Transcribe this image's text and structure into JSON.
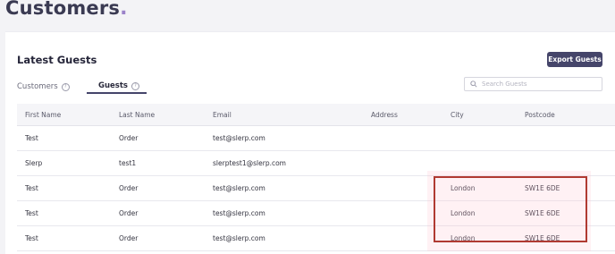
{
  "header": {
    "title": "Customers",
    "title_dot": "."
  },
  "section": {
    "title": "Latest Guests",
    "export_label": "Export Guests"
  },
  "tabs": [
    {
      "label": "Customers",
      "active": false
    },
    {
      "label": "Guests",
      "active": true
    }
  ],
  "search": {
    "placeholder": "Search Guests",
    "value": ""
  },
  "table": {
    "columns": [
      "First Name",
      "Last Name",
      "Email",
      "Address",
      "City",
      "Postcode"
    ],
    "rows": [
      [
        "Test",
        "Order",
        "test@slerp.com",
        "",
        "",
        ""
      ],
      [
        "Slerp",
        "test1",
        "slerptest1@slerp.com",
        "",
        "",
        ""
      ],
      [
        "Test",
        "Order",
        "test@slerp.com",
        "",
        "London",
        "SW1E 6DE"
      ],
      [
        "Test",
        "Order",
        "test@slerp.com",
        "",
        "London",
        "SW1E 6DE"
      ],
      [
        "Test",
        "Order",
        "test@slerp.com",
        "",
        "London",
        "SW1E 6DE"
      ]
    ]
  },
  "icons": {
    "help": "help-circle-icon",
    "search": "search-icon"
  },
  "colors": {
    "accent": "#45456a",
    "highlight": "#b03a32",
    "title_dot": "#9b82c9"
  }
}
